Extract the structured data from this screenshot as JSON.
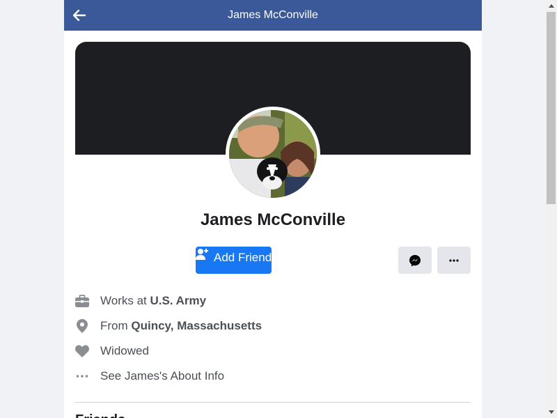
{
  "header": {
    "title": "James McConville",
    "back_icon": "arrow-left-icon",
    "background": "#3b5998"
  },
  "profile": {
    "name": "James McConville",
    "cover_color": "#1c1e21"
  },
  "actions": {
    "add_friend_label": "Add Friend",
    "add_friend_icon": "add-person-icon",
    "messenger_icon": "messenger-icon",
    "more_icon": "more-dots-icon",
    "accent": "#1877f2"
  },
  "intro": {
    "work_prefix": "Works at ",
    "work_value": "U.S. Army",
    "from_prefix": "From ",
    "from_value": "Quincy, Massachusetts",
    "relationship": "Widowed",
    "about_link": "See James's About Info"
  },
  "next_section": {
    "heading": "Friends"
  }
}
